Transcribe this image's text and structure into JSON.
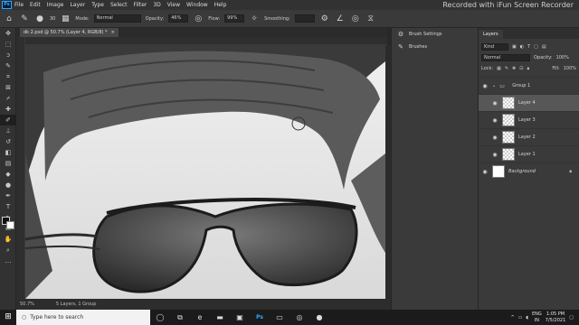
{
  "menubar": {
    "logo": "Ps",
    "items": [
      "File",
      "Edit",
      "Image",
      "Layer",
      "Type",
      "Select",
      "Filter",
      "3D",
      "View",
      "Window",
      "Help"
    ]
  },
  "watermark": "Recorded with iFun Screen Recorder",
  "options": {
    "mode_label": "Mode:",
    "mode_value": "Normal",
    "opacity_label": "Opacity:",
    "opacity_value": "46%",
    "flow_label": "Flow:",
    "flow_value": "99%",
    "smoothing_label": "Smoothing:",
    "brush_size": "30"
  },
  "document": {
    "tab_title": "dk 2.psd @ 50.7% (Layer 4, RGB/8) *",
    "tab_close": "×"
  },
  "status": {
    "zoom": "50.7%",
    "layers_info": "5 Layers, 1 Group"
  },
  "mid_panel": {
    "items": [
      {
        "icon": "brush-settings-icon",
        "label": "Brush Settings"
      },
      {
        "icon": "brushes-icon",
        "label": "Brushes"
      }
    ]
  },
  "layers_panel": {
    "tab": "Layers",
    "filter_label": "Kind",
    "blend_mode": "Normal",
    "opacity_label": "Opacity:",
    "opacity_value": "100%",
    "lock_label": "Lock:",
    "fill_label": "Fill:",
    "fill_value": "100%",
    "group": "Group 1",
    "layers": [
      "Layer 4",
      "Layer 3",
      "Layer 2",
      "Layer 1"
    ],
    "background": "Background"
  },
  "taskbar": {
    "search_placeholder": "Type here to search",
    "ps_label": "Ps",
    "lang": "ENG",
    "region": "IN",
    "time": "1:05 PM",
    "date": "7/5/2021"
  },
  "colors": {
    "accent": "#31a8ff",
    "panel": "#3a3a3a",
    "selected_layer": "#575757"
  }
}
